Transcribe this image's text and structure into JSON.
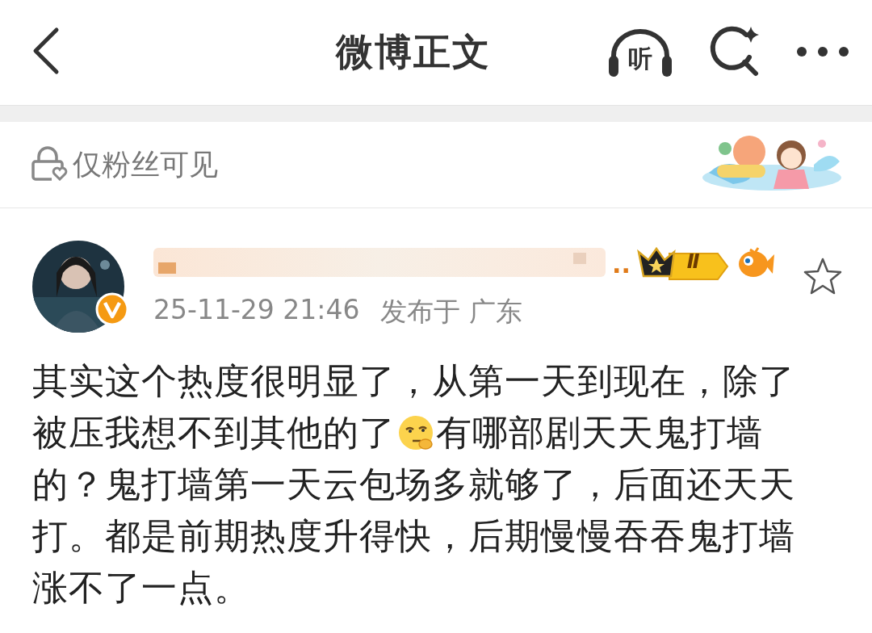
{
  "nav": {
    "title": "微博正文",
    "listen_label": "听"
  },
  "visibility": {
    "label": "仅粉丝可见"
  },
  "post": {
    "author": {
      "name_visible": "..",
      "name_blurred": true,
      "verified": true,
      "level_badge": "Ⅱ"
    },
    "time": "25-11-29 21:46",
    "location": "发布于 广东",
    "starred": false,
    "body_lines": [
      [
        {
          "kind": "text",
          "text": "其实这个热度很明显了，从第一天到现在，除了"
        }
      ],
      [
        {
          "kind": "text",
          "text": "被压我想不到其他的了"
        },
        {
          "kind": "emoji"
        },
        {
          "kind": "text",
          "text": "有哪部剧天天鬼打墙"
        }
      ],
      [
        {
          "kind": "text",
          "text": "的？鬼打墙第一天云包场多就够了，后面还天天"
        }
      ],
      [
        {
          "kind": "text",
          "text": "打。都是前期热度升得快，后期慢慢吞吞鬼打墙"
        }
      ],
      [
        {
          "kind": "text",
          "text": "涨不了一点。"
        }
      ]
    ]
  }
}
